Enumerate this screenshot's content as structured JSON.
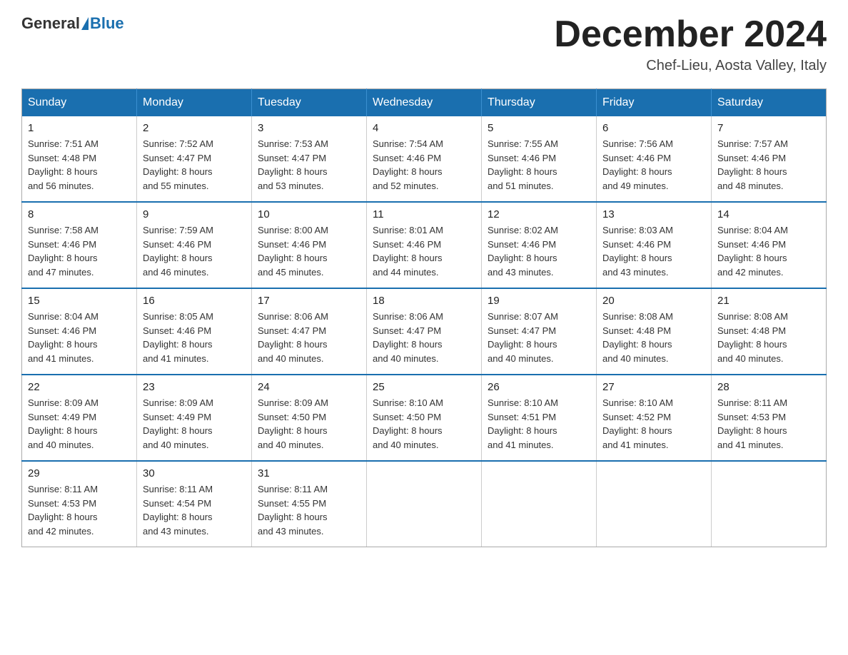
{
  "header": {
    "logo_general": "General",
    "logo_blue": "Blue",
    "month_title": "December 2024",
    "location": "Chef-Lieu, Aosta Valley, Italy"
  },
  "weekdays": [
    "Sunday",
    "Monday",
    "Tuesday",
    "Wednesday",
    "Thursday",
    "Friday",
    "Saturday"
  ],
  "weeks": [
    [
      {
        "day": "1",
        "sunrise": "7:51 AM",
        "sunset": "4:48 PM",
        "daylight": "8 hours and 56 minutes."
      },
      {
        "day": "2",
        "sunrise": "7:52 AM",
        "sunset": "4:47 PM",
        "daylight": "8 hours and 55 minutes."
      },
      {
        "day": "3",
        "sunrise": "7:53 AM",
        "sunset": "4:47 PM",
        "daylight": "8 hours and 53 minutes."
      },
      {
        "day": "4",
        "sunrise": "7:54 AM",
        "sunset": "4:46 PM",
        "daylight": "8 hours and 52 minutes."
      },
      {
        "day": "5",
        "sunrise": "7:55 AM",
        "sunset": "4:46 PM",
        "daylight": "8 hours and 51 minutes."
      },
      {
        "day": "6",
        "sunrise": "7:56 AM",
        "sunset": "4:46 PM",
        "daylight": "8 hours and 49 minutes."
      },
      {
        "day": "7",
        "sunrise": "7:57 AM",
        "sunset": "4:46 PM",
        "daylight": "8 hours and 48 minutes."
      }
    ],
    [
      {
        "day": "8",
        "sunrise": "7:58 AM",
        "sunset": "4:46 PM",
        "daylight": "8 hours and 47 minutes."
      },
      {
        "day": "9",
        "sunrise": "7:59 AM",
        "sunset": "4:46 PM",
        "daylight": "8 hours and 46 minutes."
      },
      {
        "day": "10",
        "sunrise": "8:00 AM",
        "sunset": "4:46 PM",
        "daylight": "8 hours and 45 minutes."
      },
      {
        "day": "11",
        "sunrise": "8:01 AM",
        "sunset": "4:46 PM",
        "daylight": "8 hours and 44 minutes."
      },
      {
        "day": "12",
        "sunrise": "8:02 AM",
        "sunset": "4:46 PM",
        "daylight": "8 hours and 43 minutes."
      },
      {
        "day": "13",
        "sunrise": "8:03 AM",
        "sunset": "4:46 PM",
        "daylight": "8 hours and 43 minutes."
      },
      {
        "day": "14",
        "sunrise": "8:04 AM",
        "sunset": "4:46 PM",
        "daylight": "8 hours and 42 minutes."
      }
    ],
    [
      {
        "day": "15",
        "sunrise": "8:04 AM",
        "sunset": "4:46 PM",
        "daylight": "8 hours and 41 minutes."
      },
      {
        "day": "16",
        "sunrise": "8:05 AM",
        "sunset": "4:46 PM",
        "daylight": "8 hours and 41 minutes."
      },
      {
        "day": "17",
        "sunrise": "8:06 AM",
        "sunset": "4:47 PM",
        "daylight": "8 hours and 40 minutes."
      },
      {
        "day": "18",
        "sunrise": "8:06 AM",
        "sunset": "4:47 PM",
        "daylight": "8 hours and 40 minutes."
      },
      {
        "day": "19",
        "sunrise": "8:07 AM",
        "sunset": "4:47 PM",
        "daylight": "8 hours and 40 minutes."
      },
      {
        "day": "20",
        "sunrise": "8:08 AM",
        "sunset": "4:48 PM",
        "daylight": "8 hours and 40 minutes."
      },
      {
        "day": "21",
        "sunrise": "8:08 AM",
        "sunset": "4:48 PM",
        "daylight": "8 hours and 40 minutes."
      }
    ],
    [
      {
        "day": "22",
        "sunrise": "8:09 AM",
        "sunset": "4:49 PM",
        "daylight": "8 hours and 40 minutes."
      },
      {
        "day": "23",
        "sunrise": "8:09 AM",
        "sunset": "4:49 PM",
        "daylight": "8 hours and 40 minutes."
      },
      {
        "day": "24",
        "sunrise": "8:09 AM",
        "sunset": "4:50 PM",
        "daylight": "8 hours and 40 minutes."
      },
      {
        "day": "25",
        "sunrise": "8:10 AM",
        "sunset": "4:50 PM",
        "daylight": "8 hours and 40 minutes."
      },
      {
        "day": "26",
        "sunrise": "8:10 AM",
        "sunset": "4:51 PM",
        "daylight": "8 hours and 41 minutes."
      },
      {
        "day": "27",
        "sunrise": "8:10 AM",
        "sunset": "4:52 PM",
        "daylight": "8 hours and 41 minutes."
      },
      {
        "day": "28",
        "sunrise": "8:11 AM",
        "sunset": "4:53 PM",
        "daylight": "8 hours and 41 minutes."
      }
    ],
    [
      {
        "day": "29",
        "sunrise": "8:11 AM",
        "sunset": "4:53 PM",
        "daylight": "8 hours and 42 minutes."
      },
      {
        "day": "30",
        "sunrise": "8:11 AM",
        "sunset": "4:54 PM",
        "daylight": "8 hours and 43 minutes."
      },
      {
        "day": "31",
        "sunrise": "8:11 AM",
        "sunset": "4:55 PM",
        "daylight": "8 hours and 43 minutes."
      },
      null,
      null,
      null,
      null
    ]
  ],
  "labels": {
    "sunrise": "Sunrise:",
    "sunset": "Sunset:",
    "daylight": "Daylight:"
  }
}
